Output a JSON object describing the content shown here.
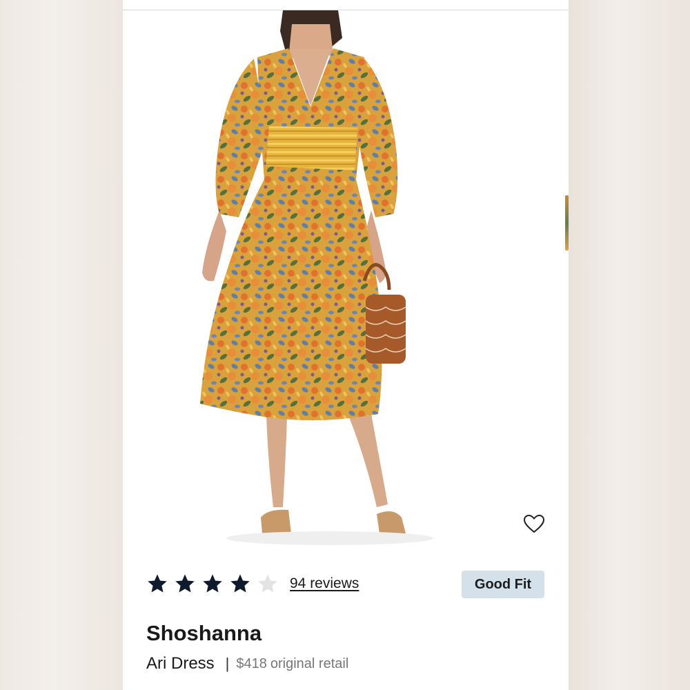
{
  "product": {
    "brand": "Shoshanna",
    "name": "Ari Dress",
    "price": "$418",
    "price_label": "original retail",
    "image_description_icon": "dress-photo"
  },
  "rating": {
    "stars_filled": 4,
    "stars_total": 5,
    "reviews_text": "94 reviews"
  },
  "fit_badge": {
    "label": "Good Fit"
  },
  "icons": {
    "favorite": "heart-outline-icon",
    "star": "star-icon"
  },
  "colors": {
    "star_filled": "#0f1b2d",
    "star_empty": "#e3e3e3",
    "badge_bg": "#d4e0ea",
    "text_primary": "#1a1a1a",
    "text_muted": "#777777"
  }
}
